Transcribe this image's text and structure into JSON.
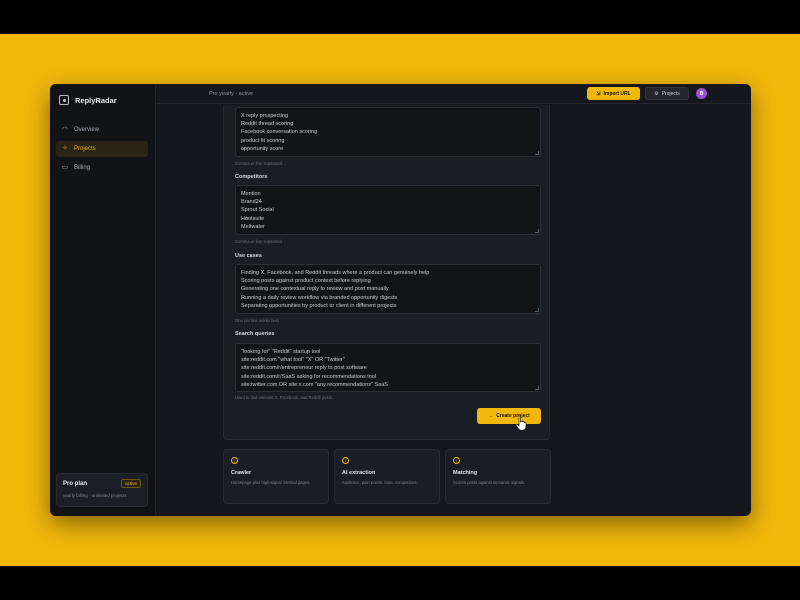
{
  "app": {
    "name": "ReplyRadar"
  },
  "sidebar": {
    "items": [
      {
        "label": "Overview",
        "icon": "gauge-icon",
        "active": false
      },
      {
        "label": "Projects",
        "icon": "projects-icon",
        "active": true
      },
      {
        "label": "Billing",
        "icon": "card-icon",
        "active": false
      }
    ],
    "plan": {
      "name": "Pro plan",
      "badge": "active",
      "sub": "yearly billing · unlimited projects"
    }
  },
  "topbar": {
    "status": "Pro yearly · active",
    "import_label": "Import URL",
    "projects_label": "Projects",
    "avatar_initial": "B"
  },
  "form": {
    "keywords": {
      "lines": [
        "X reply prospecting",
        "Reddit thread scoring",
        "Facebook conversation scoring",
        "product fit scoring",
        "opportunity score"
      ],
      "hint": "Comma or line separated."
    },
    "competitors": {
      "label": "Competitors",
      "lines": [
        "Mention",
        "Brand24",
        "Sprout Social",
        "Hootsuite",
        "Meltwater"
      ],
      "hint": "Comma or line separated."
    },
    "use_cases": {
      "label": "Use cases",
      "lines": [
        "Finding X, Facebook, and Reddit threads where a product can genuinely help",
        "Scoring posts against product context before replying",
        "Generating one contextual reply to review and post manually",
        "Running a daily review workflow via branded opportunity digests",
        "Separating opportunities by product or client in different projects"
      ],
      "hint": "One per line works best."
    },
    "search_queries": {
      "label": "Search queries",
      "lines": [
        "\"looking for\" \"Reddit\" startup tool",
        "site:reddit.com \"what tool\" \"X\" OR \"Twitter\"",
        "site:reddit.com/r/entrepreneur reply to post software",
        "site:reddit.com/r/SaaS asking for recommendations tool",
        "site:twitter.com OR site:x.com \"any recommendations\" SaaS"
      ],
      "hint": "Used to find relevant X, Facebook, and Reddit posts."
    },
    "create_label": "Create project"
  },
  "features": [
    {
      "title": "Crawler",
      "desc": "Homepage plus high-signal internal pages."
    },
    {
      "title": "AI extraction",
      "desc": "Audience, pain points, tone, competitors."
    },
    {
      "title": "Matching",
      "desc": "Scores posts against semantic signals."
    }
  ],
  "colors": {
    "accent": "#f1b80c",
    "background": "#15171c",
    "avatar": "#9b4fd6"
  }
}
